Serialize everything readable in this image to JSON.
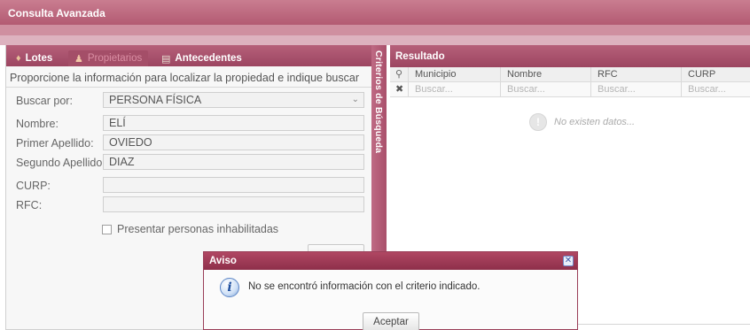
{
  "window": {
    "title": "Consulta Avanzada"
  },
  "tabs": [
    {
      "label": "Lotes",
      "icon": "lots-icon"
    },
    {
      "label": "Propietarios",
      "icon": "owner-icon"
    },
    {
      "label": "Antecedentes",
      "icon": "history-icon"
    }
  ],
  "search_panel": {
    "instructions": "Proporcione la información para localizar la propiedad e indique buscar",
    "buscar_por": {
      "label": "Buscar por:",
      "value": "PERSONA FÍSICA"
    },
    "nombre": {
      "label": "Nombre:",
      "value": "ELÍ"
    },
    "primer_apellido": {
      "label": "Primer Apellido:",
      "value": "OVIEDO"
    },
    "segundo_apellido": {
      "label": "Segundo Apellido:",
      "value": "DIAZ"
    },
    "curp": {
      "label": "CURP:",
      "value": ""
    },
    "rfc": {
      "label": "RFC:",
      "value": ""
    },
    "inhabilitadas": {
      "label": "Presentar personas inhabilitadas",
      "checked": false
    }
  },
  "side_bar": {
    "label": "Criterios de Búsqueda"
  },
  "results": {
    "title": "Resultado",
    "columns": [
      "Municipio",
      "Nombre",
      "RFC",
      "CURP"
    ],
    "filter_placeholder": "Buscar...",
    "empty_message": "No existen datos..."
  },
  "dialog": {
    "title": "Aviso",
    "message": "No se encontró información con el criterio indicado.",
    "button": "Aceptar",
    "icon": "info-icon"
  },
  "colors": {
    "brand": "#b35a72",
    "header_dark": "#9c4561",
    "dialog_header": "#9a3e58"
  }
}
